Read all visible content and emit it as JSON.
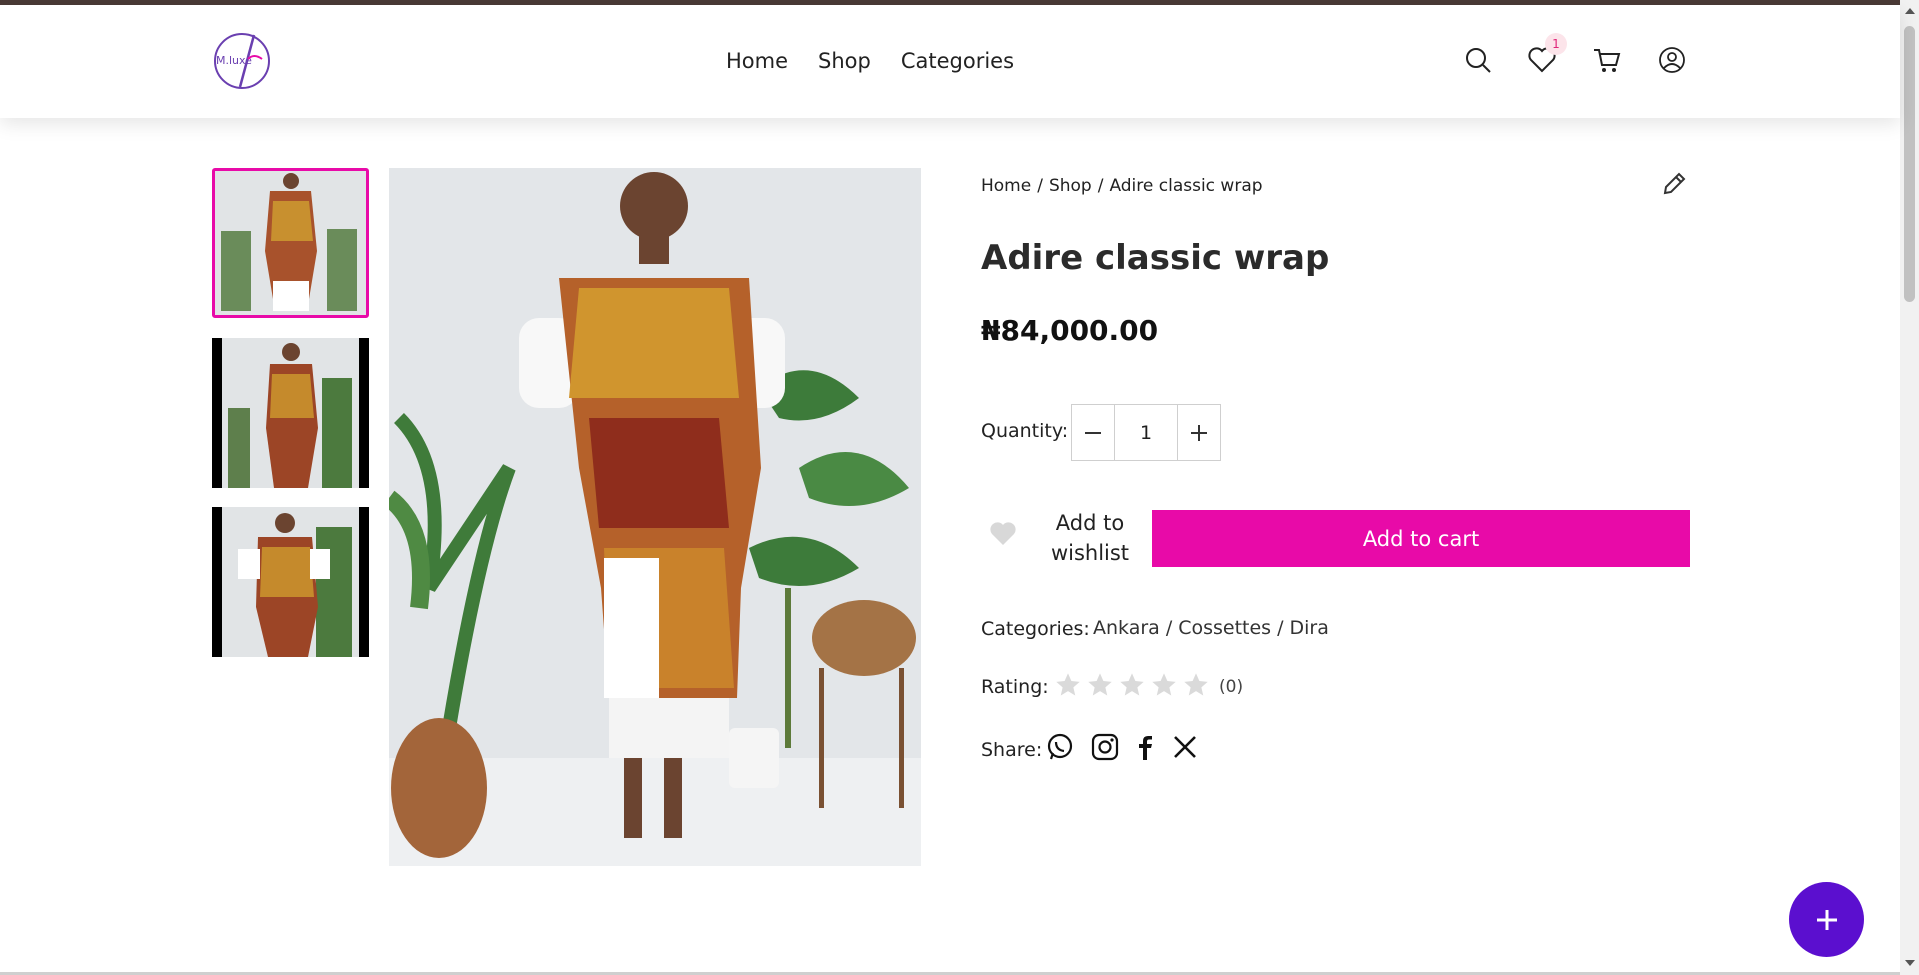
{
  "header": {
    "logo_text": "M.luxe",
    "nav": [
      "Home",
      "Shop",
      "Categories"
    ],
    "wishlist_count": "1"
  },
  "breadcrumb": [
    "Home",
    "Shop",
    "Adire classic wrap"
  ],
  "product": {
    "title": "Adire classic wrap",
    "price": "₦84,000.00",
    "quantity_label": "Quantity:",
    "quantity": "1",
    "wishlist_label": "Add to wishlist",
    "cart_label": "Add to cart",
    "categories_label": "Categories:",
    "categories": [
      "Ankara",
      "Cossettes",
      "Dira"
    ],
    "rating_label": "Rating:",
    "rating_stars": 0,
    "rating_count": "(0)",
    "share_label": "Share:",
    "share_targets": [
      "whatsapp-icon",
      "instagram-icon",
      "facebook-icon",
      "x-icon"
    ]
  },
  "colors": {
    "accent": "#e80aa8",
    "fab": "#5b0fcf"
  }
}
